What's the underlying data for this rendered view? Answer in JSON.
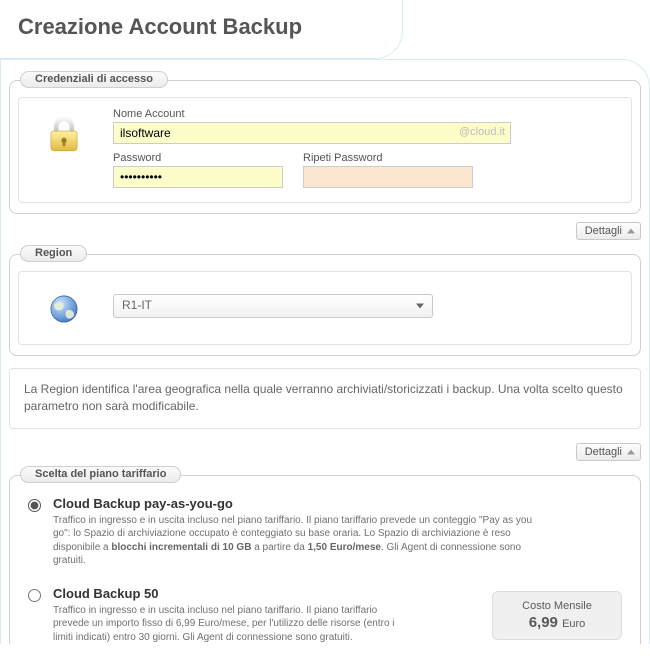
{
  "page_title": "Creazione Account Backup",
  "sections": {
    "credentials": {
      "legend": "Credenziali di accesso",
      "account_label": "Nome Account",
      "account_value": "ilsoftware",
      "domain_suffix": "@cloud.it",
      "password_label": "Password",
      "password_value": "••••••••••",
      "repeat_label": "Ripeti Password",
      "repeat_value": ""
    },
    "region": {
      "legend": "Region",
      "selected": "R1-IT",
      "info": "La Region identifica l'area geografica nella quale verranno archiviati/storicizzati i backup. Una volta scelto questo parametro non sarà modificabile."
    },
    "plans": {
      "legend": "Scelta del piano tariffario",
      "items": [
        {
          "id": "payg",
          "title": "Cloud Backup pay-as-you-go",
          "desc_pre": "Traffico in ingresso e in uscita incluso nel piano tariffario. Il piano tariffario prevede un conteggio \"Pay as you go\": lo Spazio di archiviazione occupato è conteggiato su base oraria. Lo Spazio di archiviazione è reso disponibile a ",
          "desc_bold1": "blocchi incrementali di 10 GB",
          "desc_mid": " a partire da ",
          "desc_bold2": "1,50 Euro/mese",
          "desc_post": ". Gli Agent di connessione sono gratuiti.",
          "selected": true
        },
        {
          "id": "cb50",
          "title": "Cloud Backup 50",
          "desc": "Traffico in ingresso e in uscita incluso nel piano tariffario. Il piano tariffario prevede un importo fisso di 6,99 Euro/mese, per l'utilizzo delle risorse (entro i limiti indicati) entro 30 giorni. Gli Agent di connessione sono gratuiti.",
          "price_label": "Costo Mensile",
          "price_value": "6,99",
          "price_currency": "Euro",
          "selected": false
        }
      ]
    }
  },
  "buttons": {
    "dettagli": "Dettagli"
  }
}
